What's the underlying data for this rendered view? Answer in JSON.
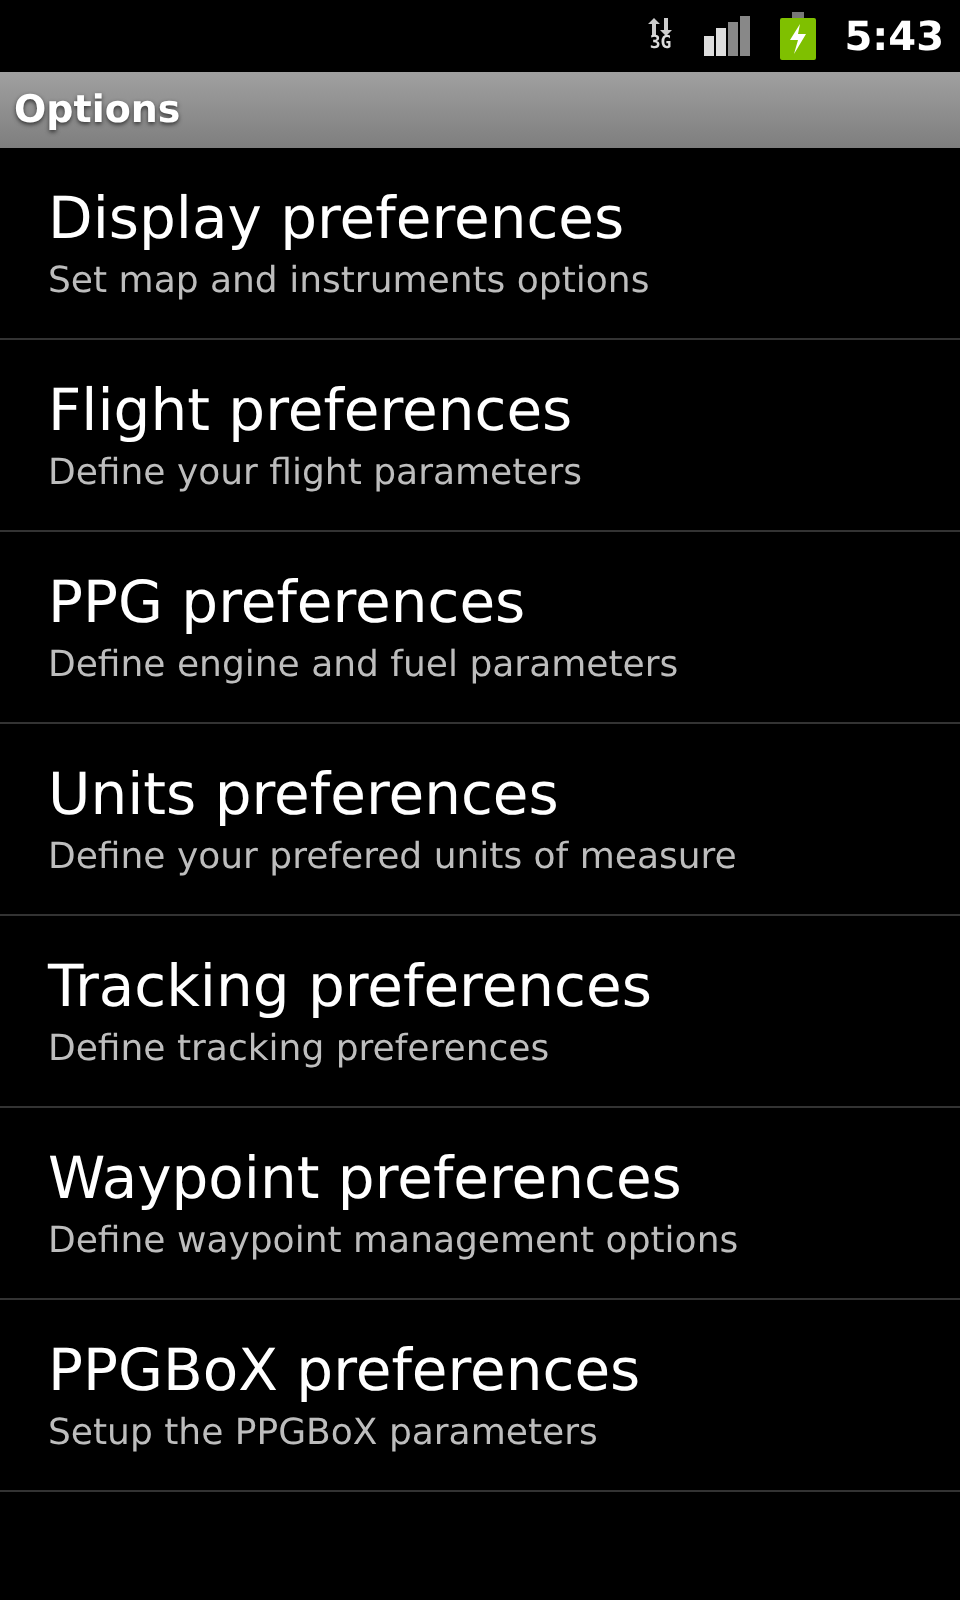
{
  "status_bar": {
    "network_type": "3G",
    "time": "5:43"
  },
  "title_bar": {
    "title": "Options"
  },
  "items": [
    {
      "title": "Display preferences",
      "summary": "Set map and instruments options"
    },
    {
      "title": "Flight preferences",
      "summary": "Define your flight parameters"
    },
    {
      "title": "PPG preferences",
      "summary": "Define engine and fuel parameters"
    },
    {
      "title": "Units preferences",
      "summary": "Define your prefered units of measure"
    },
    {
      "title": "Tracking preferences",
      "summary": "Define tracking preferences"
    },
    {
      "title": "Waypoint preferences",
      "summary": "Define waypoint management options"
    },
    {
      "title": "PPGBoX preferences",
      "summary": "Setup the PPGBoX parameters"
    }
  ]
}
